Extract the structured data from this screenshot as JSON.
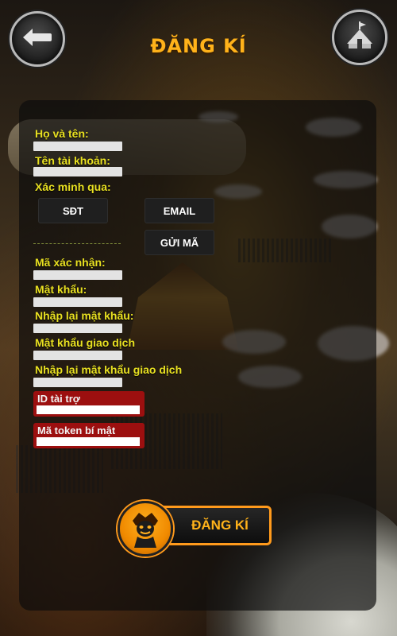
{
  "title": "ĐĂNG KÍ",
  "form": {
    "full_name_label": "Họ và tên:",
    "account_name_label": "Tên tài khoản:",
    "verify_via_label": "Xác minh qua:",
    "sms_button": "SĐT",
    "email_button": "EMAIL",
    "send_code_button": "GỬI MÃ",
    "verify_code_label": "Mã xác nhận:",
    "password_label": "Mật khẩu:",
    "password_confirm_label": "Nhập lại mật khẩu:",
    "trade_password_label": "Mật khẩu giao dịch",
    "trade_password_confirm_label": "Nhập lại mật khẩu giao dịch",
    "sponsor_id_label": "ID tài trợ",
    "secret_token_label": "Mã token bí mật"
  },
  "register_button": "ĐĂNG KÍ",
  "icons": {
    "back": "back-arrow-icon",
    "fortress": "fortress-tent-icon",
    "avatar": "mascot-avatar-icon"
  },
  "colors": {
    "title": "#ffb21a",
    "label": "#e8e021",
    "accent": "#ff9a1c",
    "red_box": "#9c0f0f"
  }
}
